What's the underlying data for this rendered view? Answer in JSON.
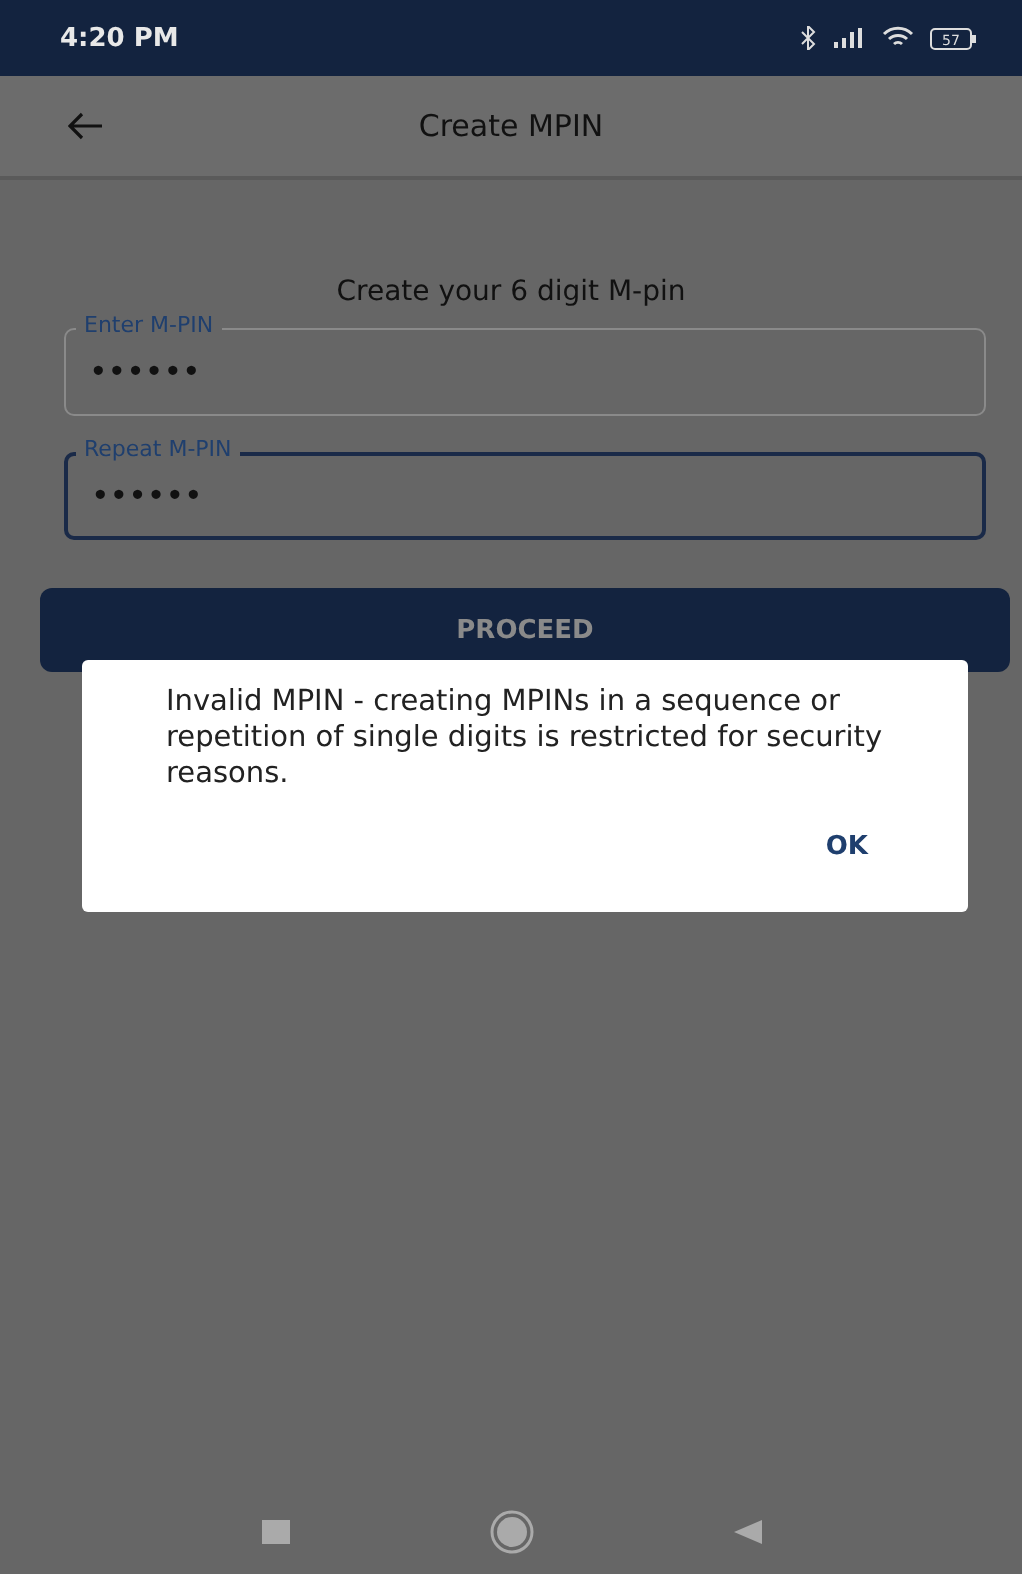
{
  "status_bar": {
    "time": "4:20 PM",
    "battery": "57"
  },
  "app_bar": {
    "title": "Create MPIN"
  },
  "form": {
    "heading": "Create your 6 digit M-pin",
    "fields": [
      {
        "label": "Enter M-PIN",
        "value": "••••••",
        "focused": false
      },
      {
        "label": "Repeat M-PIN",
        "value": "••••••",
        "focused": true
      }
    ],
    "button": "PROCEED"
  },
  "dialog": {
    "message": "Invalid MPIN - creating MPINs in a sequence or repetition of single digits is restricted for security reasons.",
    "button": "OK"
  }
}
